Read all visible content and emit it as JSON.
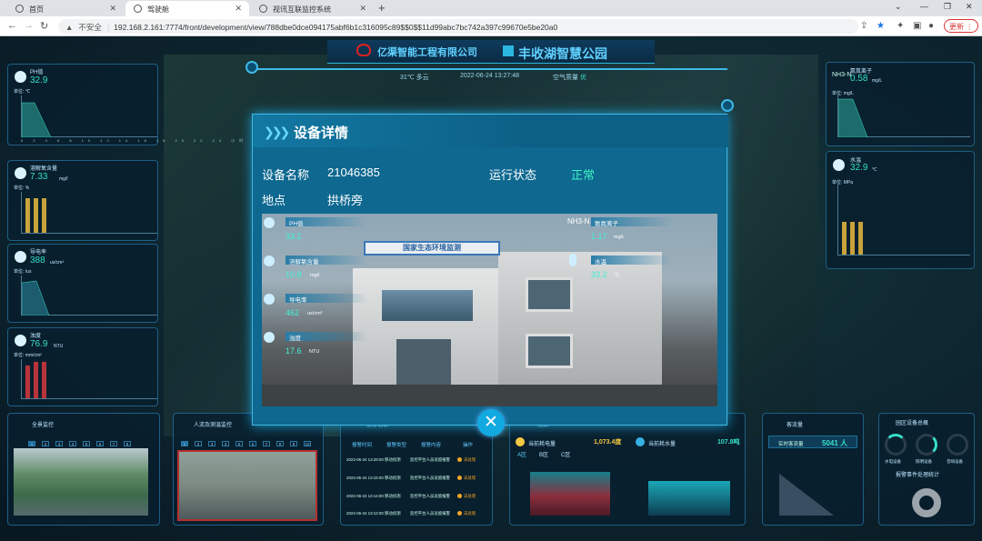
{
  "browser": {
    "tabs": [
      {
        "label": "首页",
        "active": false
      },
      {
        "label": "驾驶舱",
        "active": true
      },
      {
        "label": "视讯互联监控系统",
        "active": false
      }
    ],
    "url_insecure": "不安全",
    "url": "192.168.2.161:7774/front/development/view/788dbe0dce094175abf6b1c316095c89$$0$$11d99abc7bc742a397c99670e5be20a0",
    "update_label": "更新"
  },
  "header": {
    "company": "亿渠智能工程有限公司",
    "park": "丰收湖智慧公园",
    "weather": "31℃ 多云",
    "datetime": "2022-06-24 13:27:48",
    "air": "空气质量",
    "air_level": "优"
  },
  "left_panels": [
    {
      "title": "PH值",
      "value": "32.9",
      "unit": "",
      "ylabel": "单位: ℃"
    },
    {
      "title": "溶解氧含量",
      "value": "7.33",
      "unit": "mg/l",
      "ylabel": "单位: %"
    },
    {
      "title": "导电率",
      "value": "388",
      "unit": "us/cm²",
      "ylabel": "单位: /us"
    },
    {
      "title": "浊度",
      "value": "76.9",
      "unit": "NTU",
      "ylabel": "单位: mm/cm²"
    }
  ],
  "right_panels": [
    {
      "title": "氨氮离子",
      "value": "0.58",
      "unit": "mg/L",
      "ylabel": "单位: mg/L"
    },
    {
      "title": "水温",
      "value": "32.9",
      "unit": "℃",
      "ylabel": "单位: MPa"
    }
  ],
  "hour_ticks": "0 2 4 6 8 10 12 14 16 18 20 22 24 小时",
  "bottom": {
    "global_title": "全景监控",
    "flow_title": "人流及测温监控",
    "alarm_title": "报警记录",
    "alarm_cols": [
      "报警时间",
      "报警类型",
      "报警内容",
      "操作"
    ],
    "alarm_rows": [
      {
        "time": "2022-06-24 13:28:00",
        "type": "移动侦测",
        "content": "监控平台人员逗留报警",
        "action": "去处理"
      },
      {
        "time": "2022-06-24 13:15:00",
        "type": "移动侦测",
        "content": "监控平台人员逗留报警",
        "action": "去处理"
      },
      {
        "time": "2022-06-24 13:14:00",
        "type": "移动侦测",
        "content": "监控平台人员逗留报警",
        "action": "去处理"
      },
      {
        "time": "2022-06-24 13:12:00",
        "type": "移动侦测",
        "content": "监控平台人员逗留报警",
        "action": "去处理"
      }
    ],
    "energy_title": "能源",
    "power_label": "当前耗电量",
    "power_value": "1,073.4度",
    "water_label": "当前耗水量",
    "water_value": "107.8吨",
    "energy_tabs": [
      "A区",
      "B区",
      "C区"
    ],
    "visitor_title": "客流量",
    "visitor_label": "实时客流量",
    "visitor_value": "5041 人",
    "device_title": "园区设备总概",
    "device_labels": [
      "水电设备",
      "照明设备",
      "音响设备"
    ],
    "event_title": "报警事件处理统计"
  },
  "modal": {
    "title": "设备详情",
    "name_label": "设备名称",
    "name_value": "21046385",
    "status_label": "运行状态",
    "status_value": "正常",
    "location_label": "地点",
    "location_value": "拱桥旁",
    "signboard": "国家生态环境监测",
    "sensors_left": [
      {
        "label": "PH值",
        "value": "33.2",
        "unit": ""
      },
      {
        "label": "溶解氧含量",
        "value": "10.8",
        "unit": "mg/l"
      },
      {
        "label": "导电率",
        "value": "462",
        "unit": "us/cm²"
      },
      {
        "label": "浊度",
        "value": "17.6",
        "unit": "NTU"
      }
    ],
    "sensors_right": [
      {
        "label": "氨氮离子",
        "value": "1.17",
        "unit": "mg/L",
        "icon_text": "NH3-N"
      },
      {
        "label": "水温",
        "value": "33.2",
        "unit": "℃"
      }
    ]
  },
  "colors": {
    "accent": "#36e0c8",
    "panel_border": "#1e5f83",
    "modal_bg": "#0e6890",
    "status_ok": "#3cf2c3"
  }
}
